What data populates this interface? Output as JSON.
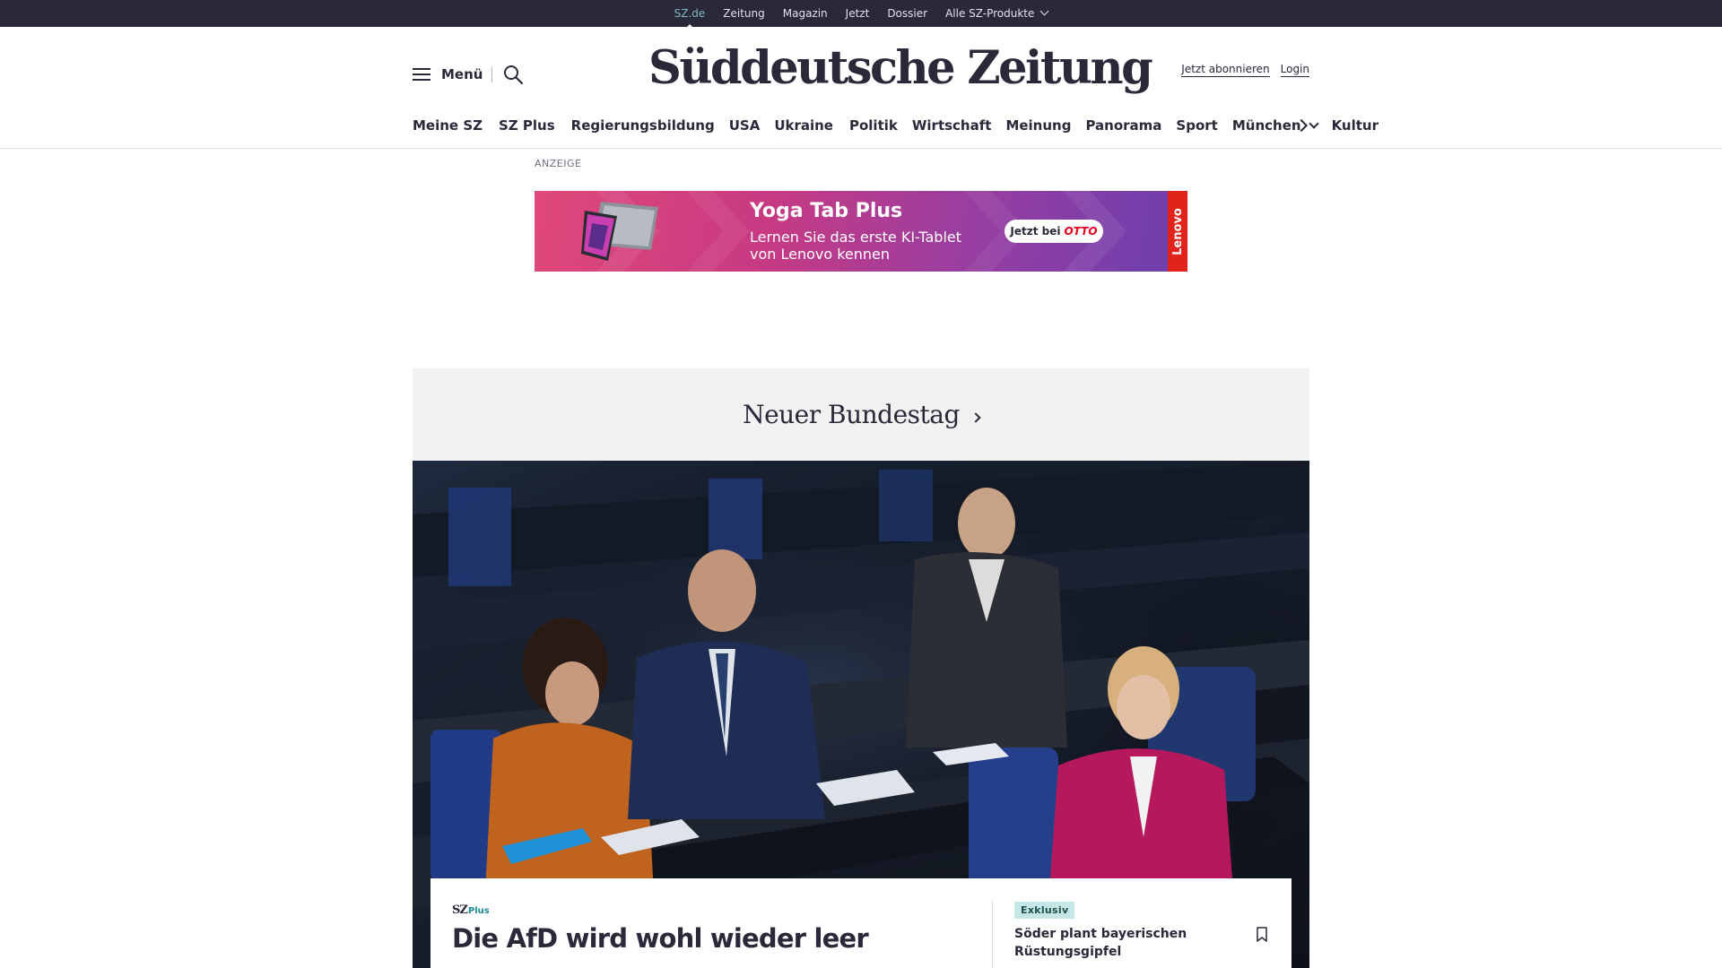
{
  "topbar": {
    "items": [
      "SZ.de",
      "Zeitung",
      "Magazin",
      "Jetzt",
      "Dossier",
      "Alle SZ-Produkte"
    ]
  },
  "header": {
    "menu_label": "Menü",
    "logo_text": "Süddeutsche Zeitung",
    "subscribe_label": "Jetzt abonnieren",
    "login_label": "Login"
  },
  "sections": [
    "Meine SZ",
    "SZ Plus",
    "Regierungsbildung",
    "USA",
    "Ukraine",
    "Politik",
    "Wirtschaft",
    "Meinung",
    "Panorama",
    "Sport",
    "München",
    "Kultur"
  ],
  "ad": {
    "label": "ANZEIGE",
    "title": "Yoga Tab Plus",
    "text": "Lernen Sie das erste KI-Tablet von Lenovo kennen",
    "cta_prefix": "Jetzt bei",
    "cta_brand": "OTTO",
    "brand": "Lenovo"
  },
  "teaser": {
    "dossier_title": "Neuer Bundestag",
    "plus_prefix": "SZ",
    "plus_suffix": "Plus",
    "headline": "Die AfD wird wohl wieder leer",
    "badge": "Exklusiv",
    "side_title": "Söder plant bayerischen Rüstungsgipfel"
  },
  "colors": {
    "topbar_bg": "#29293a",
    "active_link": "#7fb6bd",
    "plus_accent": "#1a8a94",
    "badge_bg": "#c5e8e6",
    "teaser_bg": "#f2f2f2"
  }
}
